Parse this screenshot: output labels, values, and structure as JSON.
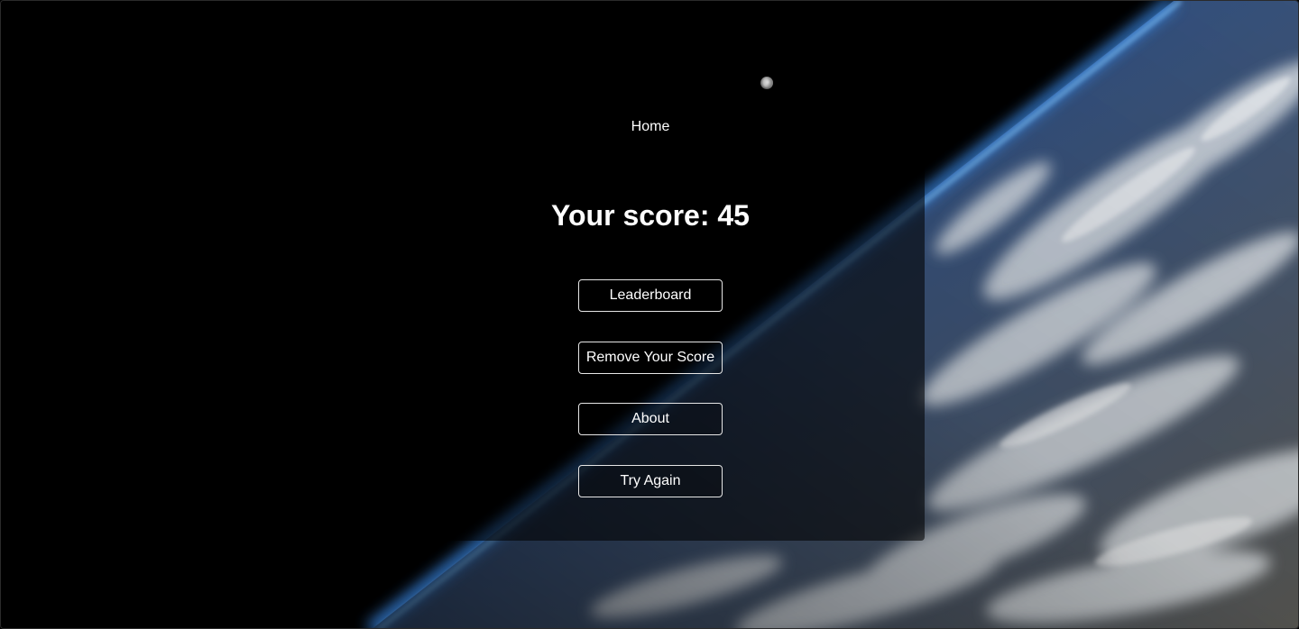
{
  "nav": {
    "home_label": "Home"
  },
  "result": {
    "score_text": "Your score: 45"
  },
  "menu": {
    "leaderboard_label": "Leaderboard",
    "remove_score_label": "Remove Your Score",
    "about_label": "About",
    "try_again_label": "Try Again"
  },
  "icons": {
    "moon": "moon-icon"
  },
  "colors": {
    "background": "#000000",
    "text": "#ffffff",
    "button_border": "#e6e6e6",
    "atmosphere": "#3d8ff0"
  }
}
